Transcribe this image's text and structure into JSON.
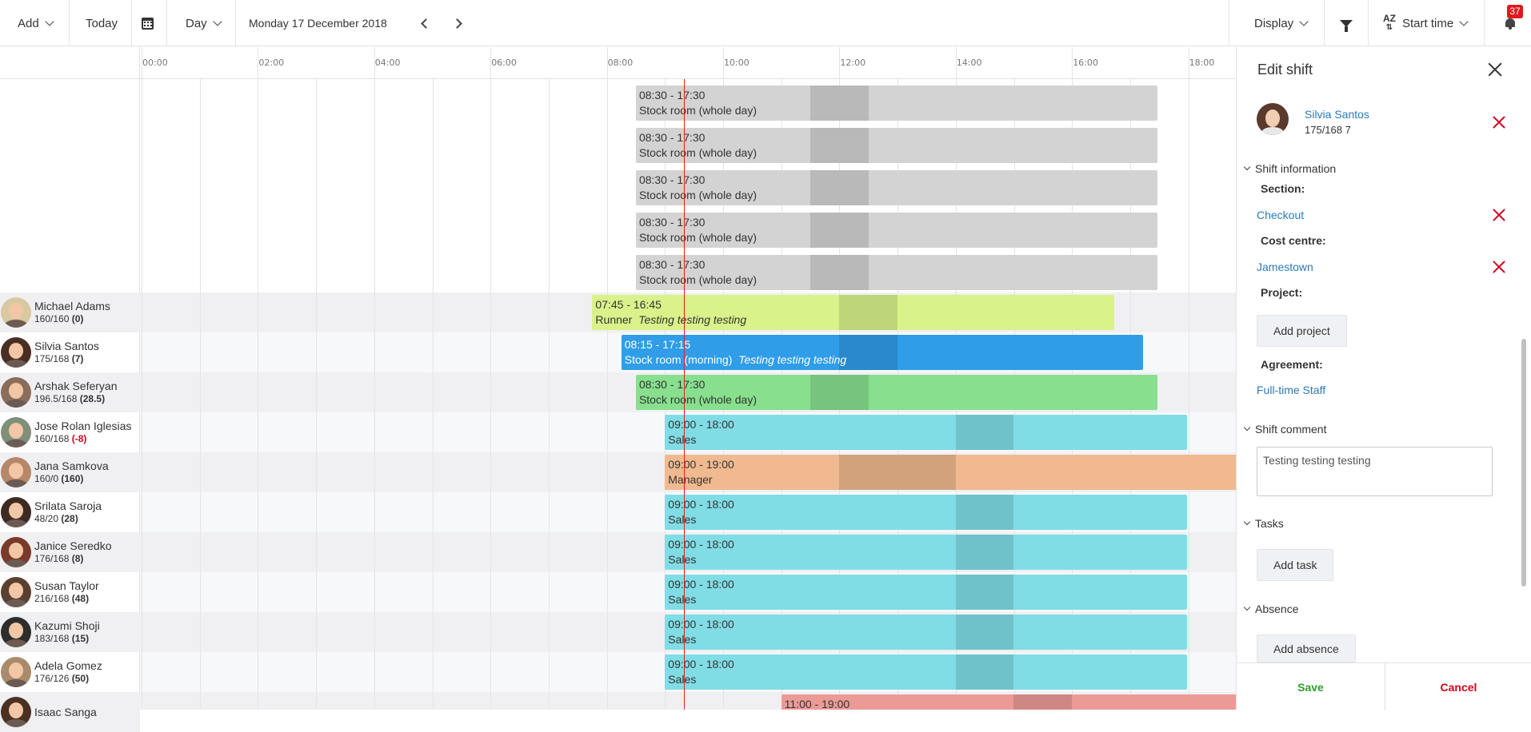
{
  "toolbar": {
    "add_label": "Add",
    "today_label": "Today",
    "calendar_icon": "calendar-icon",
    "view_label": "Day",
    "date_label": "Monday 17 December 2018",
    "display_label": "Display",
    "filter_icon": "filter-icon",
    "sort_label": "Start time",
    "sort_icon_text": "AZ",
    "notifications_count": "37"
  },
  "timeline": {
    "ticks": [
      "00:00",
      "02:00",
      "04:00",
      "06:00",
      "08:00",
      "10:00",
      "12:00",
      "14:00",
      "16:00",
      "18:00"
    ]
  },
  "colors": {
    "grey": "#d3d3d3",
    "lime": "#d9f28a",
    "blue": "#2f9de8",
    "green": "#88e08e",
    "cyan": "#80dde6",
    "orange": "#f0b98f",
    "red": "#ec9a96",
    "now_line": "#e02020"
  },
  "unassigned_shifts": [
    {
      "time": "08:30 - 17:30",
      "section": "Stock room (whole day)",
      "start": 8.5,
      "end": 17.5,
      "break_start": 11.5,
      "break_end": 12.5
    },
    {
      "time": "08:30 - 17:30",
      "section": "Stock room (whole day)",
      "start": 8.5,
      "end": 17.5,
      "break_start": 11.5,
      "break_end": 12.5
    },
    {
      "time": "08:30 - 17:30",
      "section": "Stock room (whole day)",
      "start": 8.5,
      "end": 17.5,
      "break_start": 11.5,
      "break_end": 12.5
    },
    {
      "time": "08:30 - 17:30",
      "section": "Stock room (whole day)",
      "start": 8.5,
      "end": 17.5,
      "break_start": 11.5,
      "break_end": 12.5
    },
    {
      "time": "08:30 - 17:30",
      "section": "Stock room (whole day)",
      "start": 8.5,
      "end": 17.5,
      "break_start": 11.5,
      "break_end": 12.5
    }
  ],
  "employees": [
    {
      "name": "Michael Adams",
      "hours": "160/160",
      "balance": "0",
      "negative": false,
      "shift": {
        "time": "07:45 - 16:45",
        "section": "Runner",
        "comment": "Testing testing testing",
        "color": "lime",
        "start": 7.75,
        "end": 16.75,
        "break_start": 12,
        "break_end": 13
      }
    },
    {
      "name": "Silvia Santos",
      "hours": "175/168",
      "balance": "7",
      "negative": false,
      "shift": {
        "time": "08:15 - 17:15",
        "section": "Stock room (morning)",
        "comment": "Testing testing testing",
        "color": "blue",
        "start": 8.25,
        "end": 17.25,
        "break_start": 12,
        "break_end": 13
      }
    },
    {
      "name": "Arshak Seferyan",
      "hours": "196.5/168",
      "balance": "28.5",
      "negative": false,
      "shift": {
        "time": "08:30 - 17:30",
        "section": "Stock room (whole day)",
        "comment": "",
        "color": "green",
        "start": 8.5,
        "end": 17.5,
        "break_start": 11.5,
        "break_end": 12.5
      }
    },
    {
      "name": "Jose Rolan Iglesias",
      "hours": "160/168",
      "balance": "-8",
      "negative": true,
      "shift": {
        "time": "09:00 - 18:00",
        "section": "Sales",
        "comment": "",
        "color": "cyan",
        "start": 9,
        "end": 18,
        "break_start": 14,
        "break_end": 15
      }
    },
    {
      "name": "Jana Samkova",
      "hours": "160/0",
      "balance": "160",
      "negative": false,
      "shift": {
        "time": "09:00 - 19:00",
        "section": "Manager",
        "comment": "",
        "color": "orange",
        "start": 9,
        "end": 19,
        "break_start": 12,
        "break_end": 14
      }
    },
    {
      "name": "Srilata Saroja",
      "hours": "48/20",
      "balance": "28",
      "negative": false,
      "shift": {
        "time": "09:00 - 18:00",
        "section": "Sales",
        "comment": "",
        "color": "cyan",
        "start": 9,
        "end": 18,
        "break_start": 14,
        "break_end": 15
      }
    },
    {
      "name": "Janice Seredko",
      "hours": "176/168",
      "balance": "8",
      "negative": false,
      "shift": {
        "time": "09:00 - 18:00",
        "section": "Sales",
        "comment": "",
        "color": "cyan",
        "start": 9,
        "end": 18,
        "break_start": 14,
        "break_end": 15
      }
    },
    {
      "name": "Susan Taylor",
      "hours": "216/168",
      "balance": "48",
      "negative": false,
      "shift": {
        "time": "09:00 - 18:00",
        "section": "Sales",
        "comment": "",
        "color": "cyan",
        "start": 9,
        "end": 18,
        "break_start": 14,
        "break_end": 15
      }
    },
    {
      "name": "Kazumi Shoji",
      "hours": "183/168",
      "balance": "15",
      "negative": false,
      "shift": {
        "time": "09:00 - 18:00",
        "section": "Sales",
        "comment": "",
        "color": "cyan",
        "start": 9,
        "end": 18,
        "break_start": 14,
        "break_end": 15
      }
    },
    {
      "name": "Adela Gomez",
      "hours": "176/126",
      "balance": "50",
      "negative": false,
      "shift": {
        "time": "09:00 - 18:00",
        "section": "Sales",
        "comment": "",
        "color": "cyan",
        "start": 9,
        "end": 18,
        "break_start": 14,
        "break_end": 15
      }
    },
    {
      "name": "Isaac Sanga",
      "hours": "",
      "balance": "",
      "negative": false,
      "shift": {
        "time": "11:00 - 19:00",
        "section": "",
        "comment": "",
        "color": "red",
        "start": 11,
        "end": 19,
        "break_start": 15,
        "break_end": 16
      }
    }
  ],
  "now_time": 9.33,
  "panel": {
    "title": "Edit shift",
    "employee_name": "Silvia Santos",
    "employee_hours": "175/168 7",
    "shift_info_label": "Shift information",
    "section_label": "Section:",
    "section_value": "Checkout",
    "cost_centre_label": "Cost centre:",
    "cost_centre_value": "Jamestown",
    "project_label": "Project:",
    "add_project_label": "Add project",
    "agreement_label": "Agreement:",
    "agreement_value": "Full-time Staff",
    "shift_comment_label": "Shift comment",
    "shift_comment_value": "Testing testing testing",
    "tasks_label": "Tasks",
    "add_task_label": "Add task",
    "absence_label": "Absence",
    "add_absence_label": "Add absence",
    "save_label": "Save",
    "cancel_label": "Cancel"
  }
}
